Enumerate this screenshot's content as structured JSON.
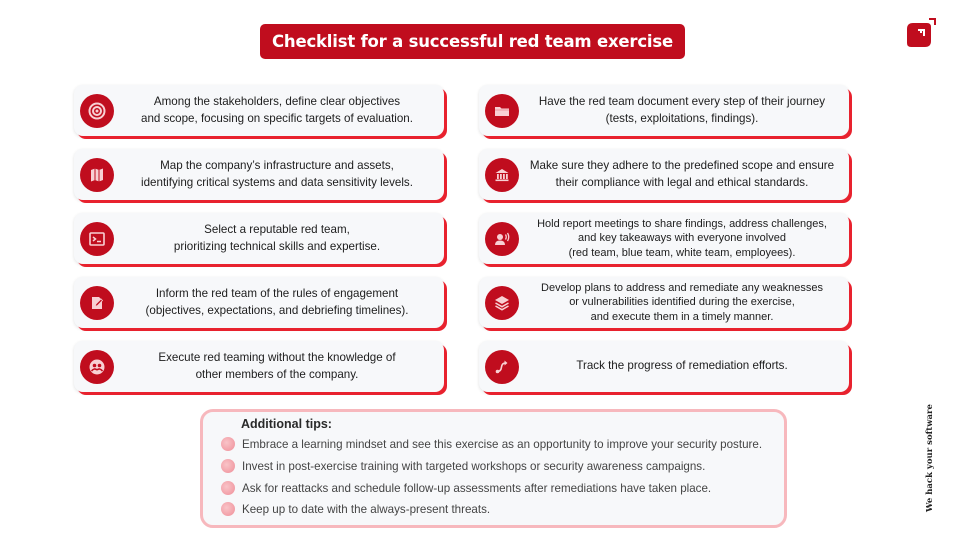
{
  "title": "Checklist for a successful red team exercise",
  "brand": {
    "logo_icon": "brand-logo-icon",
    "tagline": "We hack your software",
    "accent_color": "#c00d1e",
    "shadow_color": "#e8222e",
    "tips_border_color": "#f7b8bd"
  },
  "left_steps": [
    {
      "icon": "target-icon",
      "lines": [
        "Among the stakeholders, define clear objectives",
        "and scope, focusing on specific targets of evaluation."
      ]
    },
    {
      "icon": "map-icon",
      "lines": [
        "Map the company’s infrastructure and assets,",
        "identifying critical systems and data sensitivity levels."
      ]
    },
    {
      "icon": "terminal-icon",
      "lines": [
        "Select a reputable red team,",
        "prioritizing technical skills and expertise."
      ]
    },
    {
      "icon": "edit-document-icon",
      "lines": [
        "Inform the red team of the rules of engagement",
        "(objectives, expectations, and debriefing timelines)."
      ]
    },
    {
      "icon": "group-icon",
      "lines": [
        "Execute red teaming without the knowledge of",
        "other members of the company."
      ]
    }
  ],
  "right_steps": [
    {
      "icon": "folder-icon",
      "lines": [
        "Have the red team document every step of their journey",
        "(tests, exploitations, findings)."
      ]
    },
    {
      "icon": "institution-icon",
      "lines": [
        "Make sure they adhere to the predefined scope and ensure",
        "their compliance with legal and ethical standards."
      ]
    },
    {
      "icon": "speaker-person-icon",
      "lines": [
        "Hold report meetings to share findings, address challenges,",
        "and key takeaways with everyone involved",
        "(red team, blue team, white team, employees)."
      ]
    },
    {
      "icon": "layers-icon",
      "lines": [
        "Develop plans to address and remediate any weaknesses",
        "or vulnerabilities identified during the exercise,",
        "and execute them in a timely manner."
      ]
    },
    {
      "icon": "route-icon",
      "lines": [
        "Track the progress of remediation efforts."
      ]
    }
  ],
  "tips": {
    "title": "Additional tips:",
    "items": [
      "Embrace a learning mindset and see this exercise as an opportunity to improve your security posture.",
      "Invest in post-exercise training with targeted workshops or security awareness campaigns.",
      "Ask for reattacks and schedule follow-up assessments after remediations have taken place.",
      "Keep up to date with the always-present threats."
    ]
  }
}
